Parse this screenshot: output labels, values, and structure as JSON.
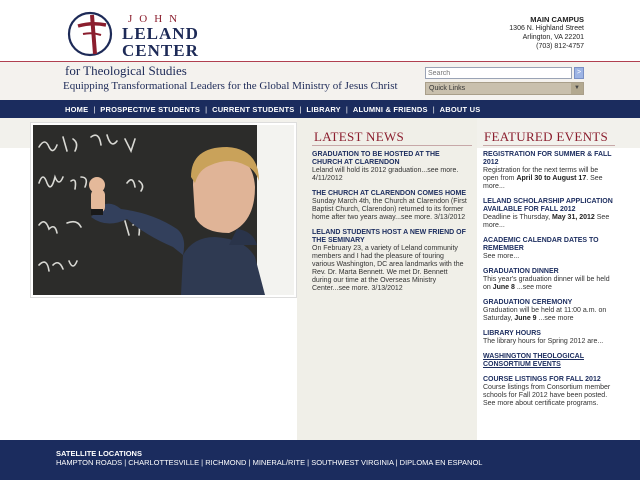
{
  "header": {
    "logo_john": "JOHN",
    "logo_leland": "LELAND",
    "logo_center": "CENTER",
    "for_theo": "for Theological Studies",
    "tagline": "Equipping Transformational Leaders for the Global Ministry of Jesus Christ"
  },
  "campus": {
    "title": "MAIN CAMPUS",
    "street": "1306 N. Highland Street",
    "city": "Arlington, VA 22201",
    "phone": "(703) 812-4757"
  },
  "search": {
    "placeholder": "Search",
    "button": ">"
  },
  "quick_links": {
    "label": "Quick Links",
    "arrow": "▼"
  },
  "nav": {
    "items": [
      "HOME",
      "PROSPECTIVE STUDENTS",
      "CURRENT STUDENTS",
      "LIBRARY",
      "ALUMNI & FRIENDS",
      "ABOUT US"
    ],
    "separator": "|"
  },
  "latest_news": {
    "title": "LATEST NEWS",
    "items": [
      {
        "title": "GRADUATION TO BE HOSTED AT THE CHURCH AT CLARENDON",
        "body": "Leland will hold its 2012 graduation...see more. 4/11/2012"
      },
      {
        "title": "THE CHURCH AT CLARENDON COMES HOME",
        "body": "Sunday March 4th, the Church at Clarendon (First Baptist Church, Clarendon) returned to its former home after two years away...see more. 3/13/2012"
      },
      {
        "title": "LELAND STUDENTS HOST A NEW FRIEND OF THE SEMINARY",
        "body": "On February 23, a variety of Leland community members and I had the pleasure of touring various Washington, DC area landmarks with the Rev. Dr. Marta Bennett. We met Dr. Bennett during our time at the Overseas Ministry Center...see more. 3/13/2012"
      }
    ]
  },
  "featured_events": {
    "title": "FEATURED EVENTS",
    "items": [
      {
        "title": "REGISTRATION FOR SUMMER & FALL 2012",
        "body_pre": "Registration for the next terms will be open from ",
        "body_bold": "April 30 to August 17",
        "body_post": ". See more..."
      },
      {
        "title": "LELAND SCHOLARSHIP APPLICATION AVAILABLE FOR FALL 2012",
        "body_pre": "Deadline is Thursday, ",
        "body_bold": "May 31, 2012",
        "body_post": " See more..."
      },
      {
        "title": "ACADEMIC CALENDAR DATES TO REMEMBER",
        "body_pre": "See more...",
        "body_bold": "",
        "body_post": ""
      },
      {
        "title": "GRADUATION DINNER",
        "body_pre": "This year's graduation dinner will be held on ",
        "body_bold": "June 8",
        "body_post": " ...see more"
      },
      {
        "title": "GRADUATION CEREMONY",
        "body_pre": "Graduation will be held at 11:00 a.m. on Saturday, ",
        "body_bold": "June 9",
        "body_post": " ...see more"
      },
      {
        "title": "LIBRARY HOURS",
        "body_pre": "The library hours for Spring 2012 are...",
        "body_bold": "",
        "body_post": ""
      },
      {
        "title": "WASHINGTON THEOLOGICAL CONSORTIUM EVENTS",
        "body_pre": "",
        "body_bold": "",
        "body_post": ""
      },
      {
        "title": "COURSE LISTINGS FOR FALL 2012",
        "body_pre": "Course listings from Consortium member schools for Fall 2012 have been posted. See more about certificate programs.",
        "body_bold": "",
        "body_post": ""
      }
    ]
  },
  "footer": {
    "title": "SATELLITE LOCATIONS",
    "links": "HAMPTON ROADS | CHARLOTTESVILLE | RICHMOND | MINERAL/RITE | SOUTHWEST VIRGINIA | DIPLOMA EN ESPANOL"
  },
  "colors": {
    "navy": "#1b2c5e",
    "maroon": "#8b1e2e",
    "beige": "#f0efe8"
  }
}
